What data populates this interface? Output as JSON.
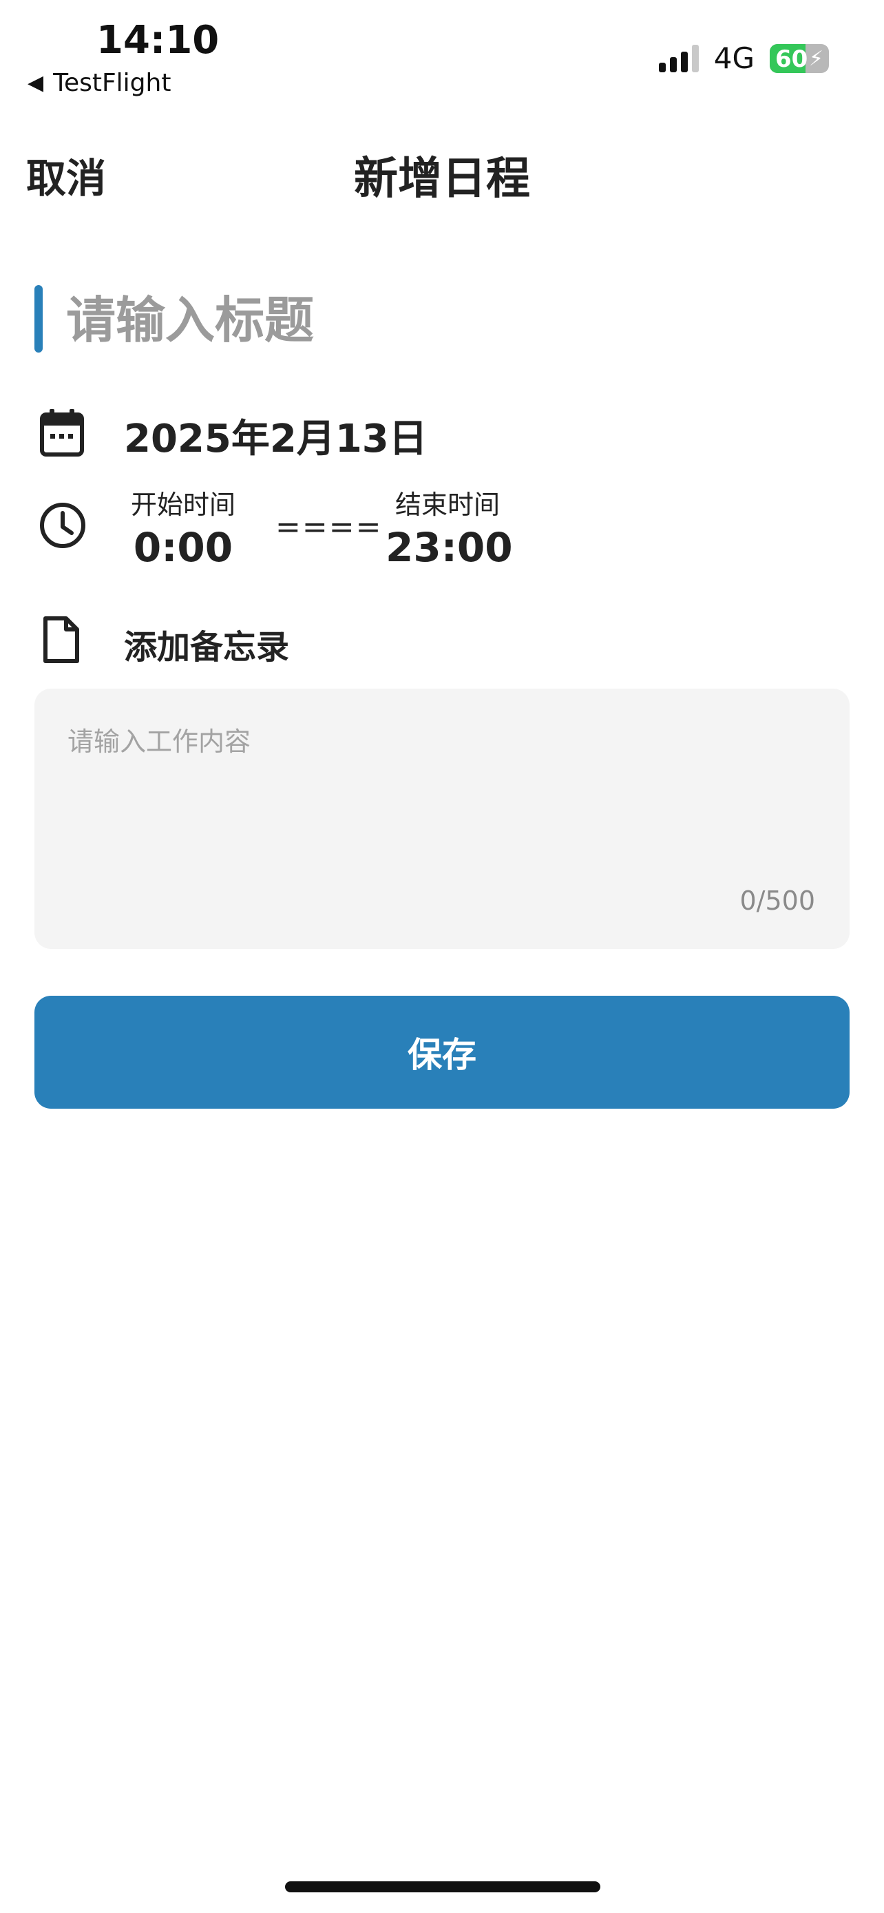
{
  "status_bar": {
    "time": "14:10",
    "back_app": "TestFlight",
    "network": "4G",
    "battery_level": 60,
    "battery_text": "60"
  },
  "nav": {
    "cancel_label": "取消",
    "title": "新增日程"
  },
  "form": {
    "title_placeholder": "请输入标题",
    "title_value": "",
    "date": "2025年2月13日",
    "start_label": "开始时间",
    "start_time": "0:00",
    "separator": "====",
    "end_label": "结束时间",
    "end_time": "23:00",
    "memo_label": "添加备忘录",
    "content_placeholder": "请输入工作内容",
    "content_value": "",
    "char_count": "0/500",
    "save_label": "保存"
  },
  "colors": {
    "accent": "#2980b9",
    "battery_green": "#34c759",
    "input_bg": "#f4f4f4",
    "placeholder": "#9b9b9b"
  },
  "icons": {
    "back": "back-triangle-icon",
    "signal": "cellular-signal-icon",
    "battery": "battery-charging-icon",
    "calendar": "calendar-icon",
    "clock": "clock-icon",
    "memo": "document-icon"
  }
}
